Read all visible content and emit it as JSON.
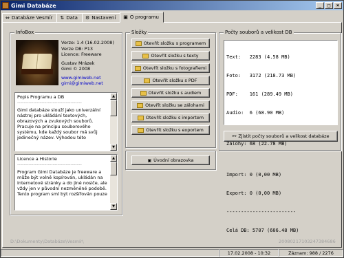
{
  "window": {
    "title": "Gimi Databáze"
  },
  "tabs": [
    {
      "label": "Databáze Vesmír",
      "icon": "arrows-icon"
    },
    {
      "label": "Data",
      "icon": "sort-icon"
    },
    {
      "label": "Nastavení",
      "icon": "settings-icon"
    },
    {
      "label": "O programu",
      "icon": "info-icon"
    }
  ],
  "infobox": {
    "title": "InfoBox",
    "version": "Verze: 1.4 (16.02.2008)",
    "db_version": "Verze DB: P13",
    "licence": "Licence: Freeware",
    "author": "Gustav Mrázek",
    "copyright": "Gimi © 2008",
    "web": "www.gimiweb.net",
    "email": "gimi@gimiweb.net"
  },
  "memo1": {
    "title": "Popis Programu a DB",
    "separator": "----------------------------------------",
    "text": "Gimi databáze slouží jako univerzální nástroj pro ukládání textových, obrazových a zvukových souborů. Pracuje na principu souborového systému, kde každý soubor má svůj jedinečný název. Výhodou této"
  },
  "memo2": {
    "title": "Licence a Historie",
    "separator": "----------------------------------------",
    "text": "Program Gimi Databáze je freeware a může být volně kopírován, ukládán na Internetové stránky a do jiné nosiče, ale vždy jen v původní nezměněné podobě. Tento program smí být rozšířován pouze"
  },
  "slozky": {
    "title": "Složky",
    "buttons": [
      "Otevřít složku s programem",
      "Otevřít složku s texty",
      "Otevřít složku s fotografiemi",
      "Otevřít složku s PDF",
      "Otevřít složku s audiem",
      "Otevřít složku se zálohami",
      "Otevřít složku s importem",
      "Otevřít složku s exportem"
    ],
    "uvod_button": "Úvodní obrazovka"
  },
  "stats": {
    "title": "Počty souborů a velikost DB",
    "lines": [
      "Text:   2283 (4.58 MB)",
      "Foto:   3172 (218.73 MB)",
      "PDF:    161 (289.49 MB)",
      "Audio:  6 (68.90 MB)",
      "",
      "Zálohy: 68 (22.78 MB)",
      "",
      "Import: 0 (0,00 MB)",
      "Export: 0 (0,00 MB)",
      "------------------------",
      "Celá DB: 5707 (606.48 MB)"
    ],
    "button": "Zjistit počty souborů a velikost databáze"
  },
  "footer": {
    "path": "D:\\Dokumenty\\Databáze\\Vesmír\\",
    "code": "20080217103247384686"
  },
  "status": {
    "cell1": "",
    "datetime": "17.02.2008 - 10:32",
    "records": "Záznam: 988 / 2276"
  }
}
